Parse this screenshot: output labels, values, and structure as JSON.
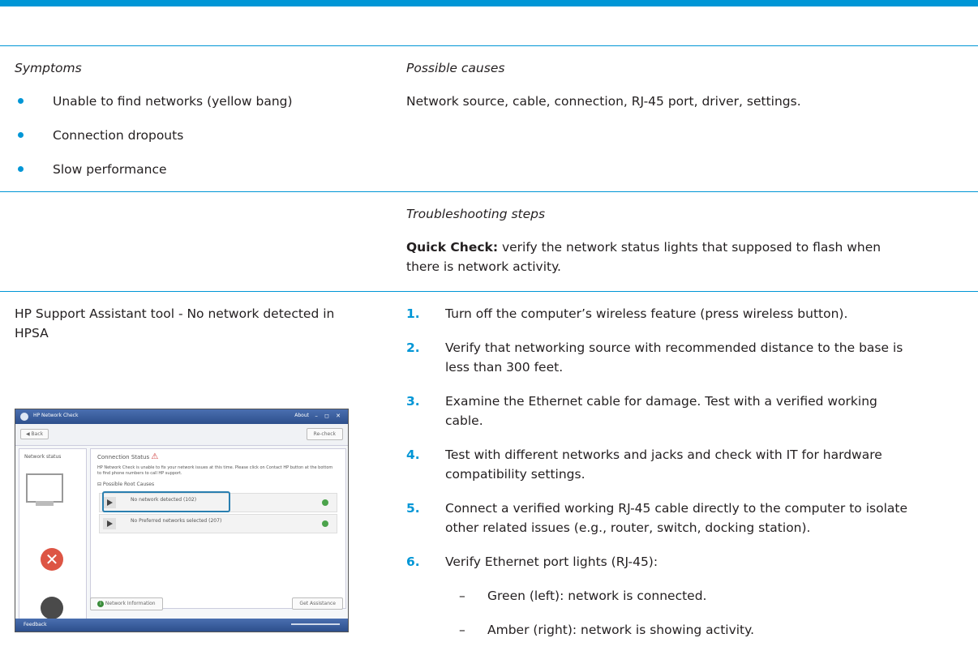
{
  "header": {
    "symptoms": "Symptoms",
    "possible_causes": "Possible causes"
  },
  "symptoms": [
    "Unable to find networks (yellow bang)",
    "Connection dropouts",
    "Slow performance"
  ],
  "causes_text": "Network source, cable, connection, RJ-45 port, driver, settings.",
  "troubleshooting": {
    "title": "Troubleshooting steps",
    "quick_check_label": "Quick Check:",
    "quick_check_line1": " verify the network status lights that supposed to flash when",
    "quick_check_line2": "there is network activity."
  },
  "hpsa": {
    "line1": "HP Support Assistant tool - No network detected in",
    "line2": "HPSA"
  },
  "steps": [
    {
      "num": "1.",
      "lines": [
        "Turn off the computer’s wireless feature (press wireless button)."
      ]
    },
    {
      "num": "2.",
      "lines": [
        "Verify that networking source with recommended distance to the base is",
        "less than 300 feet."
      ]
    },
    {
      "num": "3.",
      "lines": [
        "Examine the Ethernet cable for damage. Test with a verified working",
        "cable."
      ]
    },
    {
      "num": "4.",
      "lines": [
        "Test with different networks and jacks and check with IT for hardware",
        "compatibility settings."
      ]
    },
    {
      "num": "5.",
      "lines": [
        "Connect a verified working RJ-45 cable directly to the computer to isolate",
        "other related issues (e.g., router, switch, docking station)."
      ]
    },
    {
      "num": "6.",
      "lines": [
        "Verify Ethernet port lights (RJ-45):"
      ]
    }
  ],
  "sub_steps": [
    "Green (left): network is connected.",
    "Amber (right): network is showing activity."
  ],
  "dash_char": "–",
  "screenshot": {
    "title": "HP Network Check",
    "about": "About",
    "window_controls": "– ◻ ✕",
    "back": "◀ Back",
    "recheck": "Re-check",
    "side_label": "Network status",
    "conn_status": "Connection Status",
    "conn_desc": "HP Network Check is unable to fix your network issues at this time. Please click on Contact HP button at the bottom to find phone numbers to call HP support.",
    "root_causes": "⊟ Possible Root Causes",
    "issue1": "No network detected (102)",
    "issue2": "No Preferred networks selected (207)",
    "net_info": "Network Information",
    "get_assist": "Get Assistance",
    "feedback": "Feedback",
    "error_glyph": "✕",
    "warning_glyph": "⚠",
    "info_glyph": "i"
  },
  "colors": {
    "accent": "#0096d6"
  }
}
